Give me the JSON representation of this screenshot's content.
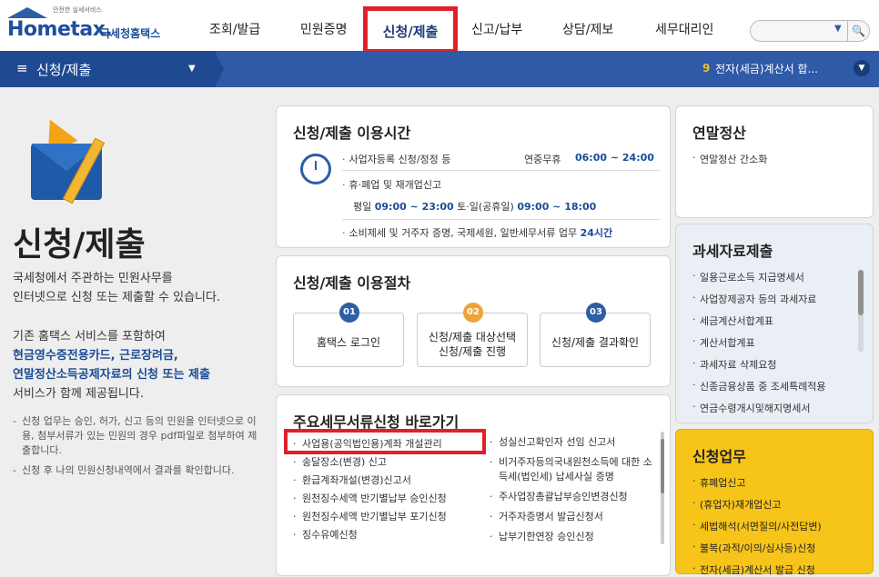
{
  "header": {
    "logo_small": "안전한 실세서비스",
    "logo_text": "Hometax.",
    "logo_sub": "국세청홈택스",
    "nav": [
      "조회/발급",
      "민원증명",
      "신청/제출",
      "신고/납부",
      "상담/제보",
      "세무대리인"
    ],
    "active_nav": "신청/제출",
    "search_placeholder": ""
  },
  "bluebar": {
    "title": "신청/제출",
    "notice_num": "9",
    "notice_text": "전자(세금)계산서 합..."
  },
  "left": {
    "title": "신청/제출",
    "desc": [
      "국세청에서 주관하는 민원사무를",
      "인터넷으로 신청 또는 제출할 수 있습니다."
    ],
    "desc2_a": "기존 홈택스 서비스를 포함하여",
    "desc2_b": "현금영수증전용카드, 근로장려금,",
    "desc2_c": "연말정산소득공제자료의 신청 또는 제출",
    "desc2_d": "서비스가 함께 제공됩니다.",
    "note1": "신청 업무는 승인, 허가, 신고 등의 민원을 인터넷으로 이용, 첨부서류가 있는 민원의 경우 pdf파일로 첨부하여 제출합니다.",
    "note2": "신청 후 나의 민원신청내역에서 결과를 확인합니다."
  },
  "hours": {
    "title": "신청/제출 이용시간",
    "r1_label": "사업자등록 신청/정정 등",
    "r1_mid": "연중무휴",
    "r1_val": "06:00 ~ 24:00",
    "r2_label": "휴·폐업 및 재개업신고",
    "r3_a": "평일",
    "r3_b": "09:00 ~ 23:00",
    "r3_c": "토·일(공휴일)",
    "r3_d": "09:00 ~ 18:00",
    "r4_label": "소비제세 및 거주자 증명, 국제세원, 일반세무서류 업무",
    "r4_val": "24시간"
  },
  "procedure": {
    "title": "신청/제출 이용절차",
    "steps": [
      {
        "num": "01",
        "l1": "홈택스 로그인",
        "l2": ""
      },
      {
        "num": "02",
        "l1": "신청/제출 대상선택",
        "l2": "신청/제출 진행"
      },
      {
        "num": "03",
        "l1": "신청/제출 결과확인",
        "l2": ""
      }
    ],
    "colors": [
      "#2d5ea6",
      "#f0a33a",
      "#2d5ea6"
    ]
  },
  "shortcuts": {
    "title": "주요세무서류신청 바로가기",
    "left": [
      "사업용(공익법인용)계좌 개설관리",
      "송달장소(변경) 신고",
      "환급계좌개설(변경)신고서",
      "원천징수세액 반기별납부 승인신청",
      "원천징수세액 반기별납부 포기신청",
      "징수유예신청"
    ],
    "right": [
      "성실신고확인자 선임 신고서",
      "비거주자등의국내원천소득에 대한 소득세(법인세) 납세사실 증명",
      "주사업장총괄납부승인변경신청",
      "거주자증명서 발급신청서",
      "납부기한연장 승인신청"
    ]
  },
  "yearend": {
    "title": "연말정산",
    "items": [
      "연말정산 간소화"
    ]
  },
  "taxdata": {
    "title": "과세자료제출",
    "items": [
      "일용근로소득 지급명세서",
      "사업장제공자 등의 과세자료",
      "세금계산서합계표",
      "계산서합계표",
      "과세자료 삭제요청",
      "신종금융상품 중 조세특례적용",
      "연금수령개시및해지명세서"
    ]
  },
  "request": {
    "title": "신청업무",
    "items": [
      "휴폐업신고",
      "(휴업자)재개업신고",
      "세법해석(서면질의/사전답변)",
      "불복(과적/이의/심사등)신청",
      "전자(세금)계산서 발급 신청"
    ]
  }
}
